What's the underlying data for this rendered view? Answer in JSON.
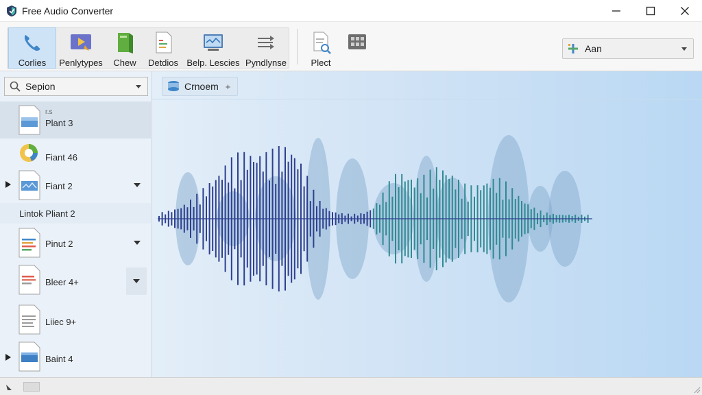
{
  "window": {
    "title": "Free Audio Converter",
    "controls": [
      "minimize",
      "maximize",
      "close"
    ]
  },
  "toolbar": {
    "buttons": [
      {
        "label": "Corlies",
        "icon": "phone-icon",
        "active": true
      },
      {
        "label": "Penlytypes",
        "icon": "video-icon",
        "active": false
      },
      {
        "label": "Chew",
        "icon": "book-icon",
        "active": false
      },
      {
        "label": "Detdios",
        "icon": "document-icon",
        "active": false
      },
      {
        "label": "Belp. Lescies",
        "icon": "monitor-icon",
        "active": false
      },
      {
        "label": "Pyndlynse",
        "icon": "shuffle-icon",
        "active": false
      },
      {
        "label": "Plect",
        "icon": "document-search-icon",
        "active": false
      },
      {
        "label": "",
        "icon": "film-icon",
        "active": false
      }
    ],
    "right_combo": {
      "value": "Aan",
      "icon": "plus-grid-icon"
    }
  },
  "sidebar": {
    "search": {
      "value": "Sepion"
    },
    "items": [
      {
        "name": "Plant 3",
        "subtitle": "r.s",
        "icon": "file-image-icon",
        "selected": true
      },
      {
        "name": "Fiant 46",
        "icon": "pie-chart-icon"
      },
      {
        "name": "Fiant 2",
        "icon": "file-image-icon",
        "expander": true,
        "dropdown": true
      },
      {
        "name": "Lintok Pliant 2",
        "icon": ""
      },
      {
        "name": "Pinut 2",
        "icon": "file-lines-icon",
        "dropdown": true
      },
      {
        "name": "Bleer 4+",
        "icon": "file-lines-red-icon",
        "dropdown": true
      },
      {
        "name": "Liiec 9+",
        "icon": "file-lines-gray-icon"
      },
      {
        "name": "Baint 4",
        "icon": "file-image-icon",
        "expander": true
      }
    ]
  },
  "main": {
    "tab": {
      "label": "Crnoem",
      "plus": "+",
      "icon": "database-icon"
    }
  },
  "colors": {
    "accent": "#2f6fb5",
    "wave_dark": "#2e3f8f",
    "wave_teal": "#2f8a92",
    "wave_shadow": "#7fa7c9"
  }
}
